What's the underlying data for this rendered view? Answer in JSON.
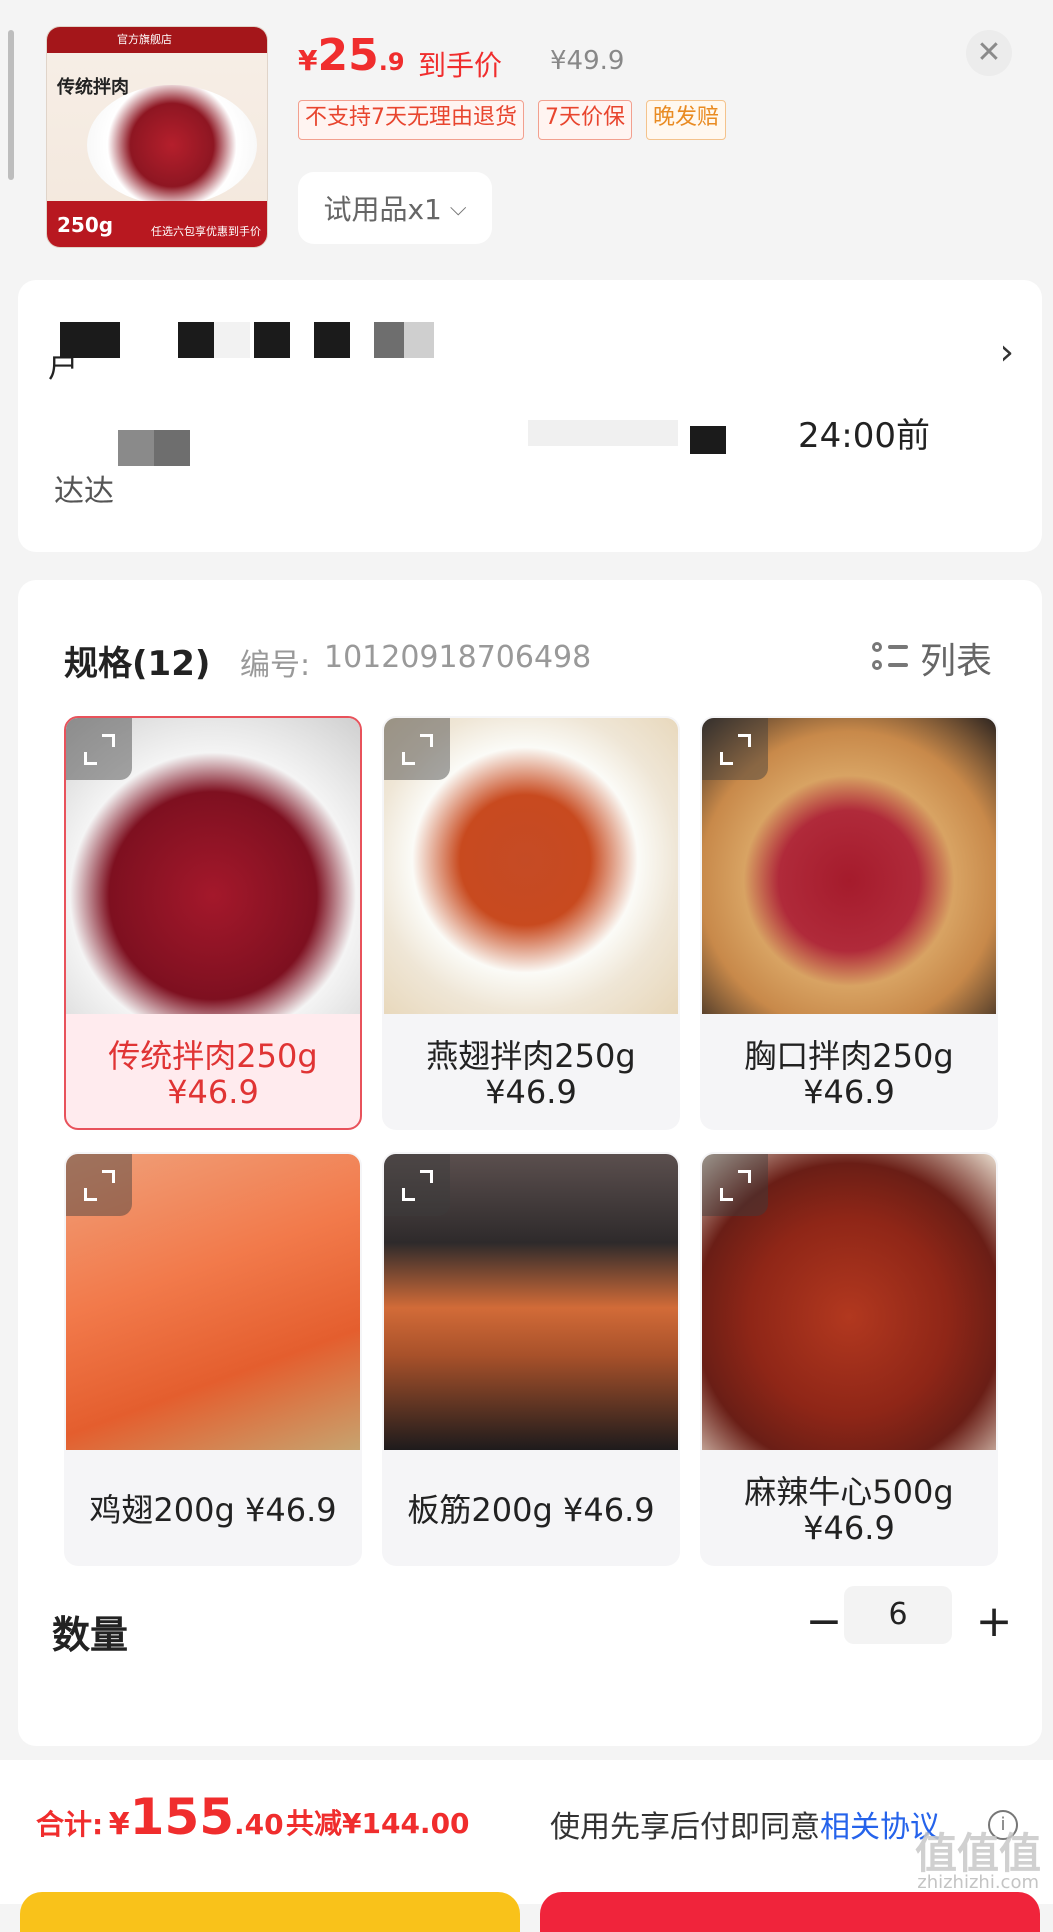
{
  "header": {
    "thumbnail": {
      "banner": "官方旗舰店",
      "title": "传统拌肉",
      "weight": "250g",
      "promo": "任选六包享优惠到手价"
    },
    "price": {
      "currency": "¥",
      "integer": "25",
      "decimal": ".9",
      "tag": "到手价",
      "original": "¥49.9"
    },
    "badges": [
      "不支持7天无理由退货",
      "7天价保",
      "晚发赔"
    ],
    "sample_select": {
      "label": "试用品x1",
      "chevron_icon": "chevron-down-icon"
    },
    "close_icon": "close-icon"
  },
  "address": {
    "partial_char_1": "户",
    "partial_char_2": "达达",
    "time_text": "24:00前",
    "arrow_icon": "chevron-right-icon"
  },
  "spec": {
    "title": "规格(12)",
    "code_label": "编号:",
    "code": "10120918706498",
    "view_toggle": "列表",
    "items": [
      {
        "label": "传统拌肉250g",
        "price": "¥46.9",
        "selected": true
      },
      {
        "label": "燕翅拌肉250g",
        "price": "¥46.9",
        "selected": false
      },
      {
        "label": "胸口拌肉250g",
        "price": "¥46.9",
        "selected": false
      },
      {
        "label": "鸡翅200g",
        "price": "¥46.9",
        "selected": false
      },
      {
        "label": "板筋200g",
        "price": "¥46.9",
        "selected": false
      },
      {
        "label": "麻辣牛心500g",
        "price": "¥46.9",
        "selected": false
      }
    ]
  },
  "quantity": {
    "label": "数量",
    "value": "6",
    "minus": "−",
    "plus": "+"
  },
  "footer": {
    "total_label": "合计:",
    "currency": "¥",
    "total_integer": "155",
    "total_decimal": ".40",
    "saving": "共减¥144.00",
    "agree_text": "使用先享后付即同意",
    "agree_link": "相关协议",
    "info_icon": "info-icon"
  },
  "colors": {
    "accent": "#f02d2d",
    "link": "#2563eb",
    "yellow_button": "#f9c21a",
    "red_button": "#f0243b"
  },
  "watermark": {
    "main": "值值值",
    "sub": "zhizhizhi.com"
  }
}
